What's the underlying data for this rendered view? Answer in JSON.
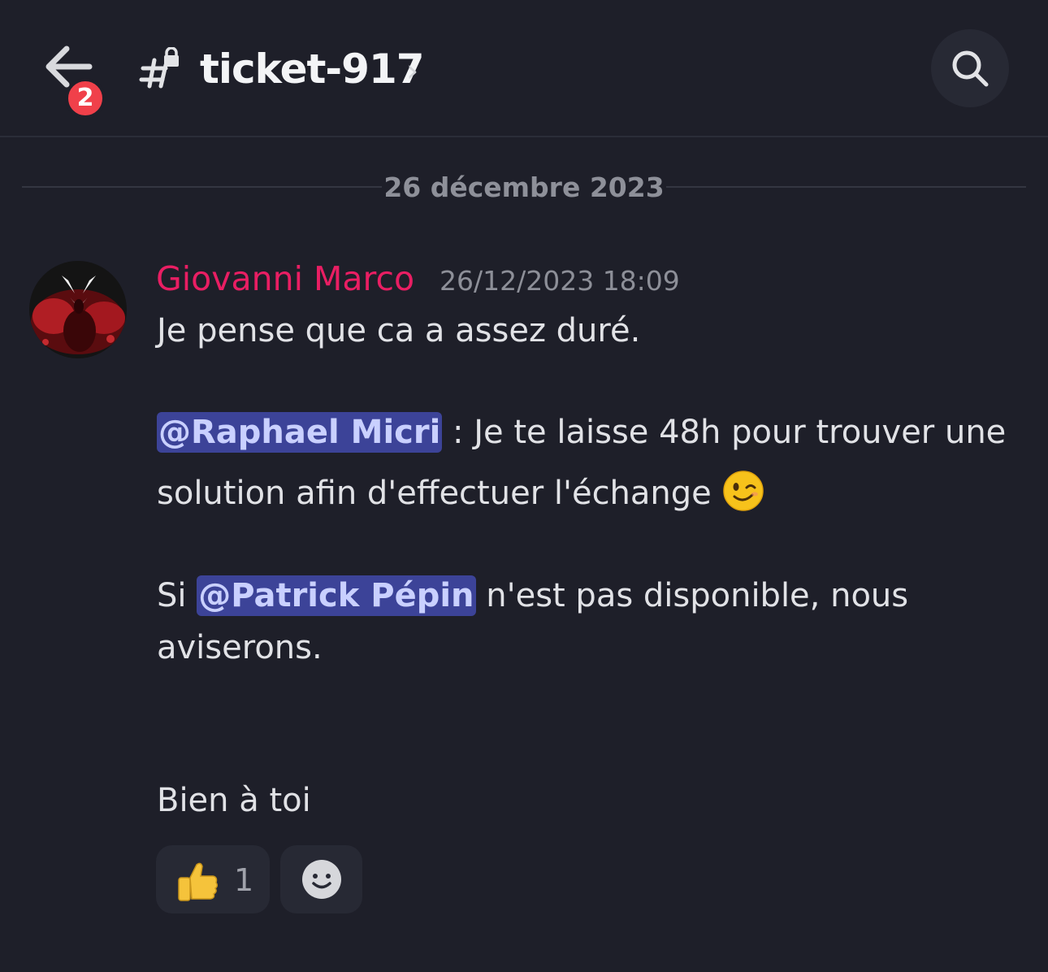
{
  "header": {
    "channel_name": "ticket-917",
    "chevron": "›",
    "unread_badge": "2",
    "back_icon": "arrow-left-icon",
    "search_icon": "search-icon",
    "channel_icon": "hash-lock-icon"
  },
  "divider": {
    "date": "26 décembre 2023"
  },
  "message": {
    "author": "Giovanni Marco",
    "author_color": "#e91e63",
    "timestamp": "26/12/2023 18:09",
    "line1": "Je pense que ca a assez duré.",
    "mention1": "@Raphael Micri",
    "line2_rest": " : Je te laisse 48h pour trouver une",
    "line3": "solution afin d'effectuer l'échange ",
    "line3_emoji": "winking-face-emoji",
    "line4_prefix": "Si ",
    "mention2": "@Patrick Pépin",
    "line4_rest": " n'est pas disponible, nous",
    "line5": "aviserons.",
    "line6": "Bien à toi"
  },
  "reactions": [
    {
      "emoji": "thumbs-up-emoji",
      "count": "1"
    }
  ],
  "add_reaction_icon": "add-reaction-smiley-icon",
  "colors": {
    "background": "#1e1f29",
    "mention_bg": "#3c4398",
    "badge": "#f0404a"
  }
}
